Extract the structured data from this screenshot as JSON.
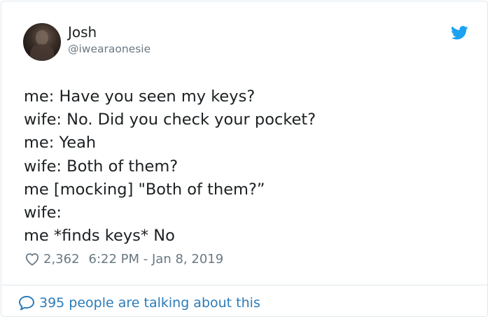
{
  "author": {
    "name": "Josh",
    "handle": "@iwearaonesie"
  },
  "tweet": {
    "lines": [
      "me: Have you seen my keys?",
      "wife: No. Did you check your pocket?",
      "me: Yeah",
      "wife: Both of them?",
      "me [mocking] \"Both of them?”",
      "wife:",
      "me *finds keys* No"
    ]
  },
  "meta": {
    "likes": "2,362",
    "timestamp": "6:22 PM - Jan 8, 2019"
  },
  "footer": {
    "talking_text": "395 people are talking about this"
  },
  "icons": {
    "brand": "twitter-bird-icon",
    "like": "heart-icon",
    "reply": "speech-bubble-icon"
  },
  "colors": {
    "twitter_blue": "#1da1f2",
    "link_blue": "#2b7bb9",
    "muted_gray": "#697882",
    "text": "#1c2022",
    "border": "#e1e8ed"
  }
}
